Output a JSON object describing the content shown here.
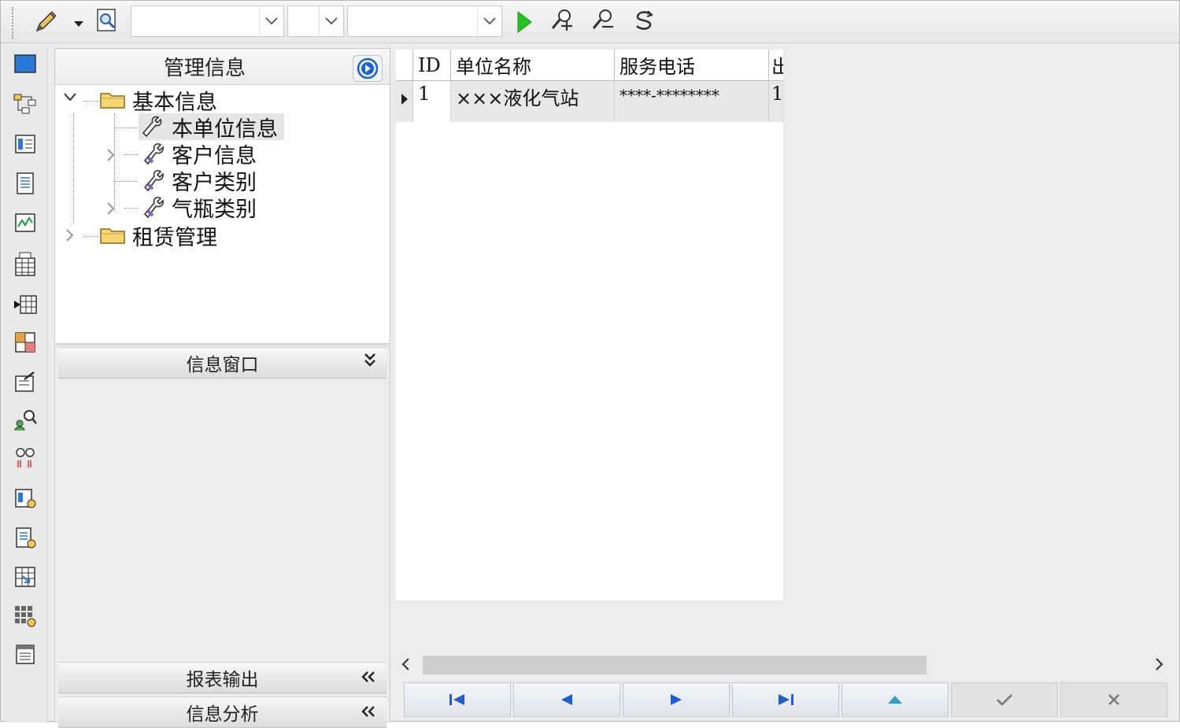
{
  "toolbar": {
    "combo1_value": "",
    "combo2_value": "",
    "combo3_value": ""
  },
  "tree": {
    "title": "管理信息",
    "items": [
      {
        "label": "基本信息"
      },
      {
        "label": "本单位信息"
      },
      {
        "label": "客户信息"
      },
      {
        "label": "客户类别"
      },
      {
        "label": "气瓶类别"
      },
      {
        "label": "租赁管理"
      }
    ]
  },
  "panels": {
    "info_window": "信息窗口",
    "report_output": "报表输出",
    "info_analysis": "信息分析"
  },
  "grid": {
    "columns": [
      "ID",
      "单位名称",
      "服务电话",
      "出"
    ],
    "rows": [
      {
        "id": "1",
        "name": "×××液化气站",
        "phone": "****-********",
        "extra": "1"
      }
    ]
  },
  "colors": {
    "nav_arrow": "#1d5fd1",
    "run_green": "#26c226",
    "disabled_icon": "#7a7a7a"
  }
}
